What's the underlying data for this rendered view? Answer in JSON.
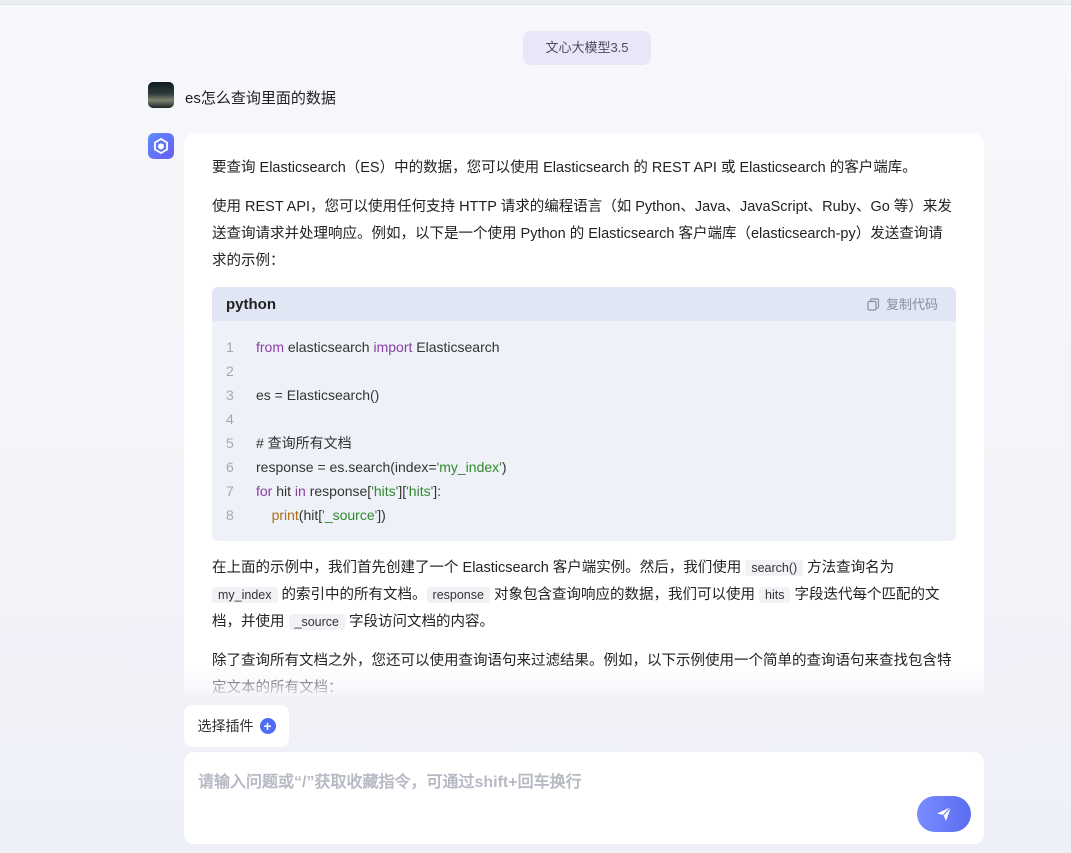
{
  "model_tag": "文心大模型3.5",
  "user": {
    "message": "es怎么查询里面的数据"
  },
  "answer": {
    "p1": "要查询 Elasticsearch（ES）中的数据，您可以使用 Elasticsearch 的 REST API 或 Elasticsearch 的客户端库。",
    "p2": "使用 REST API，您可以使用任何支持 HTTP 请求的编程语言（如 Python、Java、JavaScript、Ruby、Go 等）来发送查询请求并处理响应。例如，以下是一个使用 Python 的 Elasticsearch 客户端库（elasticsearch-py）发送查询请求的示例：",
    "code": {
      "language": "python",
      "copy_label": "复制代码",
      "line_numbers": [
        "1",
        "2",
        "3",
        "4",
        "5",
        "6",
        "7",
        "8"
      ],
      "lines": [
        {
          "a": "from",
          "b": " elasticsearch ",
          "c": "import",
          "d": " Elasticsearch"
        },
        {
          "a": ""
        },
        {
          "a": "es = Elasticsearch()"
        },
        {
          "a": ""
        },
        {
          "a": "# 查询所有文档"
        },
        {
          "a": "response = es.search(index=",
          "b": "'my_index'",
          "c": ")"
        },
        {
          "a": "for",
          "b": " hit ",
          "c": "in",
          "d": " response[",
          "e": "'hits'",
          "f": "][",
          "g": "'hits'",
          "h": "]:"
        },
        {
          "a": "    ",
          "b": "print",
          "c": "(hit[",
          "d": "'_source'",
          "e": "])"
        }
      ]
    },
    "p3": {
      "t1": "在上面的示例中，我们首先创建了一个 Elasticsearch 客户端实例。然后，我们使用 ",
      "c1": "search()",
      "t2": " 方法查询名为 ",
      "c2": "my_index",
      "t3": " 的索引中的所有文档。",
      "c3": "response",
      "t4": " 对象包含查询响应的数据，我们可以使用 ",
      "c4": "hits",
      "t5": " 字段迭代每个匹配的文档，并使用 ",
      "c5": "_source",
      "t6": " 字段访问文档的内容。"
    },
    "p4": "除了查询所有文档之外，您还可以使用查询语句来过滤结果。例如，以下示例使用一个简单的查询语句来查找包含特定文本的所有文档："
  },
  "plugin_label": "选择插件",
  "input": {
    "placeholder": "请输入问题或“/”获取收藏指令，可通过shift+回车换行",
    "value": ""
  },
  "icons": {
    "copy": "copy-icon",
    "plus": "plus-icon",
    "send": "send-icon",
    "bot": "bot-logo-icon"
  },
  "colors": {
    "accent": "#4e6cf5",
    "model_tag_bg": "#e9e6f7",
    "code_head_bg": "#e1e6f4",
    "code_bg": "#eef1f8"
  }
}
